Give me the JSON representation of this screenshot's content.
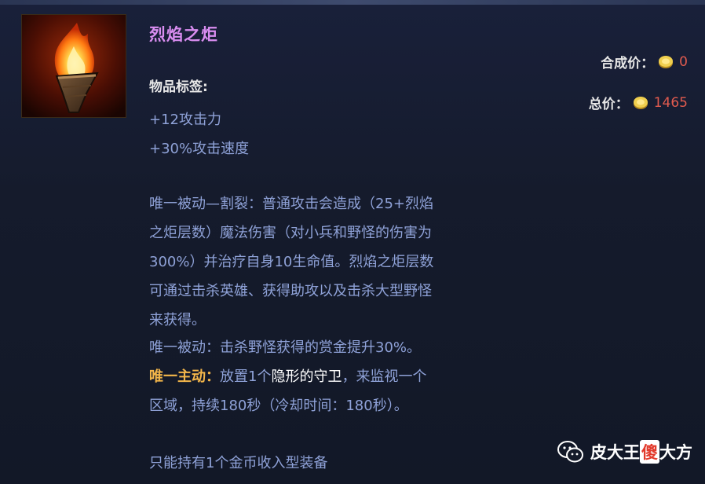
{
  "item": {
    "name": "烈焰之炬",
    "icon": "flame-torch-icon"
  },
  "prices": {
    "craft_label": "合成价：",
    "craft_value": "0",
    "total_label": "总价：",
    "total_value": "1465",
    "coin_icon": "gold-coin-icon"
  },
  "tags": {
    "label": "物品标签:"
  },
  "stats": [
    "+12攻击力",
    "+30%攻击速度"
  ],
  "passive1": [
    "唯一被动—割裂：普通攻击会造成（25+烈焰",
    "之炬层数）魔法伤害（对小兵和野怪的伤害为",
    "300%）并治疗自身10生命值。烈焰之炬层数",
    "可通过击杀英雄、获得助攻以及击杀大型野怪",
    "来获得。"
  ],
  "passive2": "唯一被动：击杀野怪获得的赏金提升30%。",
  "active": {
    "label": "唯一主动：",
    "pre": "放置1个",
    "ward": "隐形的守卫",
    "post": "，来监视一个",
    "line2": "区域，持续180秒（冷却时间：180秒）。"
  },
  "limit": "只能持有1个金币收入型装备",
  "watermark": {
    "pre": "皮大王",
    "highlight": "傻",
    "post": "大方"
  },
  "colors": {
    "background": "#151b2c",
    "item_name": "#d98df0",
    "body_text": "#8fa2d8",
    "price_value": "#e25b4f",
    "active_label": "#f3b64a",
    "ward_link": "#ffffff"
  }
}
